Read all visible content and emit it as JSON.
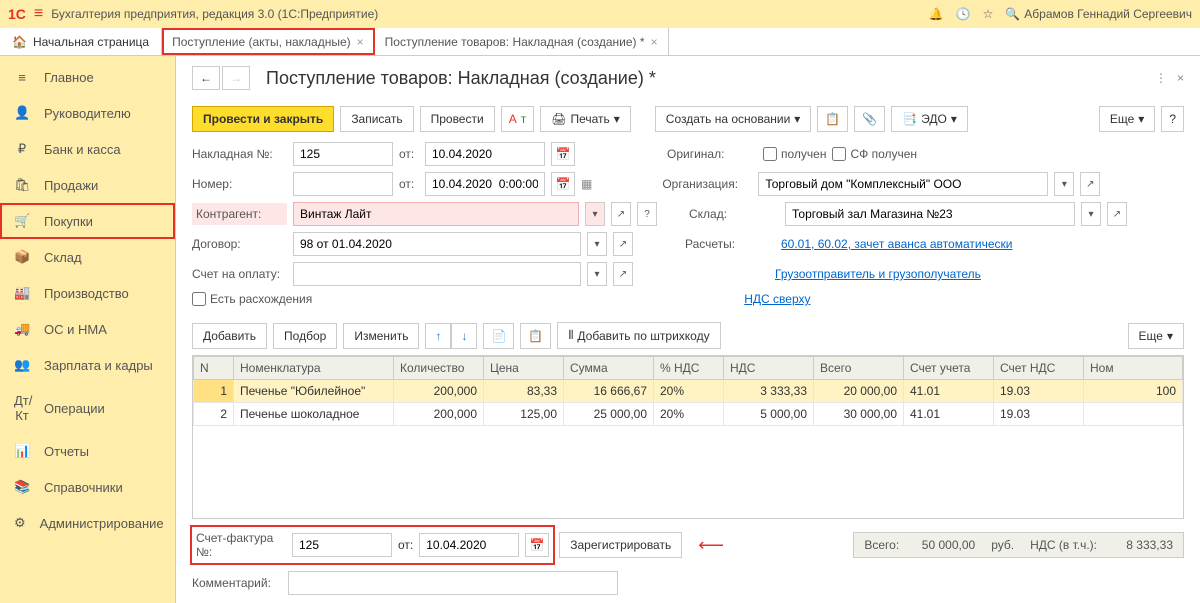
{
  "app": {
    "title": "Бухгалтерия предприятия, редакция 3.0   (1С:Предприятие)",
    "user": "Абрамов Геннадий Сергеевич"
  },
  "tabs": {
    "home": "Начальная страница",
    "t1": "Поступление (акты, накладные)",
    "t2": "Поступление товаров: Накладная (создание) *"
  },
  "sidebar": {
    "items": [
      "Главное",
      "Руководителю",
      "Банк и касса",
      "Продажи",
      "Покупки",
      "Склад",
      "Производство",
      "ОС и НМА",
      "Зарплата и кадры",
      "Операции",
      "Отчеты",
      "Справочники",
      "Администрирование"
    ]
  },
  "page": {
    "title": "Поступление товаров: Накладная (создание) *"
  },
  "toolbar": {
    "ok": "Провести и закрыть",
    "write": "Записать",
    "post": "Провести",
    "print": "Печать",
    "create_based": "Создать на основании",
    "edo": "ЭДО",
    "more": "Еще",
    "q": "?"
  },
  "form": {
    "nakl_lbl": "Накладная №:",
    "nakl_val": "125",
    "ot": "от:",
    "nakl_date": "10.04.2020",
    "num_lbl": "Номер:",
    "num_date": "10.04.2020  0:00:00",
    "orig_lbl": "Оригинал:",
    "received": "получен",
    "sf_received": "СФ получен",
    "org_lbl": "Организация:",
    "org_val": "Торговый дом \"Комплексный\" ООО",
    "contr_lbl": "Контрагент:",
    "contr_val": "Винтаж Лайт",
    "sklad_lbl": "Склад:",
    "sklad_val": "Торговый зал Магазина №23",
    "dogovor_lbl": "Договор:",
    "dogovor_val": "98 от 01.04.2020",
    "raschety_lbl": "Расчеты:",
    "raschety_link": "60.01, 60.02, зачет аванса автоматически",
    "schet_lbl": "Счет на оплату:",
    "gruz_link": "Грузоотправитель и грузополучатель",
    "rasx_lbl": "Есть расхождения",
    "nds_link": "НДС сверху"
  },
  "subtb": {
    "add": "Добавить",
    "pick": "Подбор",
    "edit": "Изменить",
    "barcode": "Добавить по штрихкоду",
    "more": "Еще"
  },
  "table": {
    "headers": [
      "N",
      "Номенклатура",
      "Количество",
      "Цена",
      "Сумма",
      "% НДС",
      "НДС",
      "Всего",
      "Счет учета",
      "Счет НДС",
      "Ном"
    ],
    "rows": [
      {
        "n": "1",
        "nom": "Печенье \"Юбилейное\"",
        "qty": "200,000",
        "price": "83,33",
        "sum": "16 666,67",
        "pnds": "20%",
        "nds": "3 333,33",
        "total": "20 000,00",
        "acc": "41.01",
        "accnds": "19.03",
        "nomc": "100"
      },
      {
        "n": "2",
        "nom": "Печенье шоколадное",
        "qty": "200,000",
        "price": "125,00",
        "sum": "25 000,00",
        "pnds": "20%",
        "nds": "5 000,00",
        "total": "30 000,00",
        "acc": "41.01",
        "accnds": "19.03",
        "nomc": ""
      }
    ]
  },
  "footer": {
    "sf_lbl": "Счет-фактура №:",
    "sf_val": "125",
    "sf_ot": "от:",
    "sf_date": "10.04.2020",
    "reg": "Зарегистрировать",
    "comment_lbl": "Комментарий:"
  },
  "totals": {
    "vsego": "Всего:",
    "vsego_val": "50 000,00",
    "rub": "руб.",
    "nds": "НДС (в т.ч.):",
    "nds_val": "8 333,33"
  }
}
